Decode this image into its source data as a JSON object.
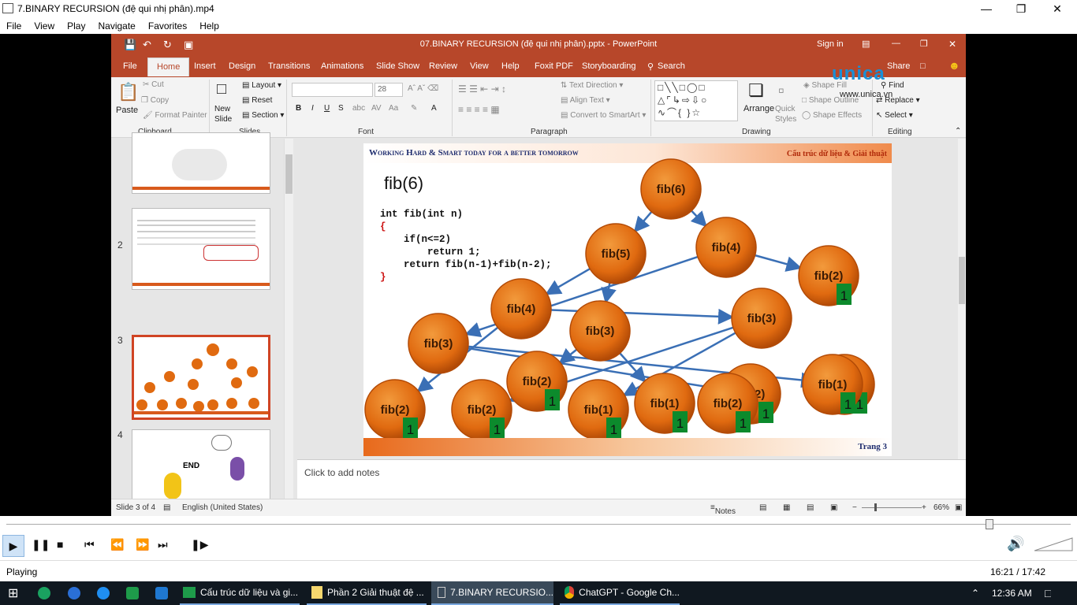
{
  "player": {
    "window_title": "7.BINARY RECURSION (đệ qui nhị phân).mp4",
    "menu": [
      "File",
      "View",
      "Play",
      "Navigate",
      "Favorites",
      "Help"
    ],
    "status": "Playing",
    "time": "16:21 / 17:42"
  },
  "ppt": {
    "doc_title": "07.BINARY RECURSION (đệ qui nhị phân).pptx  -  PowerPoint",
    "sign_in": "Sign in",
    "tabs": [
      "File",
      "Home",
      "Insert",
      "Design",
      "Transitions",
      "Animations",
      "Slide Show",
      "Review",
      "View",
      "Help",
      "Foxit PDF",
      "Storyboarding",
      "Search"
    ],
    "share": "Share",
    "ribbon": {
      "paste": "Paste",
      "cut": "Cut",
      "copy": "Copy",
      "format_painter": "Format Painter",
      "clipboard": "Clipboard",
      "new_slide": "New Slide",
      "layout": "Layout",
      "reset": "Reset",
      "section": "Section",
      "slides": "Slides",
      "font_size": "28",
      "font": "Font",
      "text_direction": "Text Direction",
      "align_text": "Align Text",
      "smartart": "Convert to SmartArt",
      "paragraph": "Paragraph",
      "arrange": "Arrange",
      "quick_styles": "Quick Styles",
      "shape_fill": "Shape Fill",
      "shape_outline": "Shape Outline",
      "shape_effects": "Shape Effects",
      "drawing": "Drawing",
      "find": "Find",
      "replace": "Replace",
      "select": "Select",
      "editing": "Editing"
    },
    "watermark": {
      "brand": "unica",
      "url": "www.unica.vn"
    },
    "thumb_numbers": [
      "2",
      "3",
      "4"
    ],
    "thumb4_end": "END",
    "notes_placeholder": "Click to add notes",
    "statusbar": {
      "slide": "Slide 3 of 4",
      "language": "English (United States)",
      "notes": "Notes",
      "zoom": "66%"
    }
  },
  "slide": {
    "header_left": "Working Hard & Smart today for a better tomorrow",
    "header_right": "Cấu trúc dữ liệu & Giải thuật",
    "title": "fib(6)",
    "code": [
      "int fib(int n)",
      "{",
      "    if(n<=2)",
      "        return 1;",
      "    return fib(n-1)+fib(n-2);",
      "}"
    ],
    "footer": "Trang 3",
    "nodes": [
      {
        "label": "fib(6)",
        "badge": ""
      },
      {
        "label": "fib(5)",
        "badge": ""
      },
      {
        "label": "fib(4)",
        "badge": ""
      },
      {
        "label": "fib(2)",
        "badge": "1"
      },
      {
        "label": "fib(4)",
        "badge": ""
      },
      {
        "label": "fib(3)",
        "badge": ""
      },
      {
        "label": "fib(3)",
        "badge": ""
      },
      {
        "label": "fib(3)",
        "badge": ""
      },
      {
        "label": "fib(2)",
        "badge": "1"
      },
      {
        "label": "fib(2)",
        "badge": "1"
      },
      {
        "label": "fib(1)",
        "badge": "1"
      },
      {
        "label": "fib(2)",
        "badge": "1"
      },
      {
        "label": "fib(1)",
        "badge": "1"
      },
      {
        "label": "fib(2)",
        "badge": "1"
      },
      {
        "label": "fib(1)",
        "badge": "1"
      },
      {
        "label": "fib(2)",
        "badge": "1"
      },
      {
        "label": "fib(1)",
        "badge": "1"
      }
    ],
    "edges": [
      [
        0,
        1
      ],
      [
        0,
        2
      ],
      [
        2,
        3
      ],
      [
        1,
        4
      ],
      [
        1,
        5
      ],
      [
        2,
        6
      ],
      [
        4,
        7
      ],
      [
        4,
        8
      ],
      [
        5,
        9
      ],
      [
        5,
        10
      ],
      [
        7,
        11
      ],
      [
        7,
        12
      ],
      [
        6,
        13
      ],
      [
        6,
        14
      ]
    ],
    "colors": {
      "node": "#e06a10",
      "node_dark": "#b24a06",
      "badge": "#0c8a2c",
      "edge": "#3a6fb5"
    }
  },
  "taskbar": {
    "items": [
      "Cấu trúc dữ liệu và gi...",
      "Phần 2 Giải thuật đệ ...",
      "7.BINARY RECURSIO...",
      "ChatGPT - Google Ch..."
    ],
    "clock": "12:36 AM"
  }
}
